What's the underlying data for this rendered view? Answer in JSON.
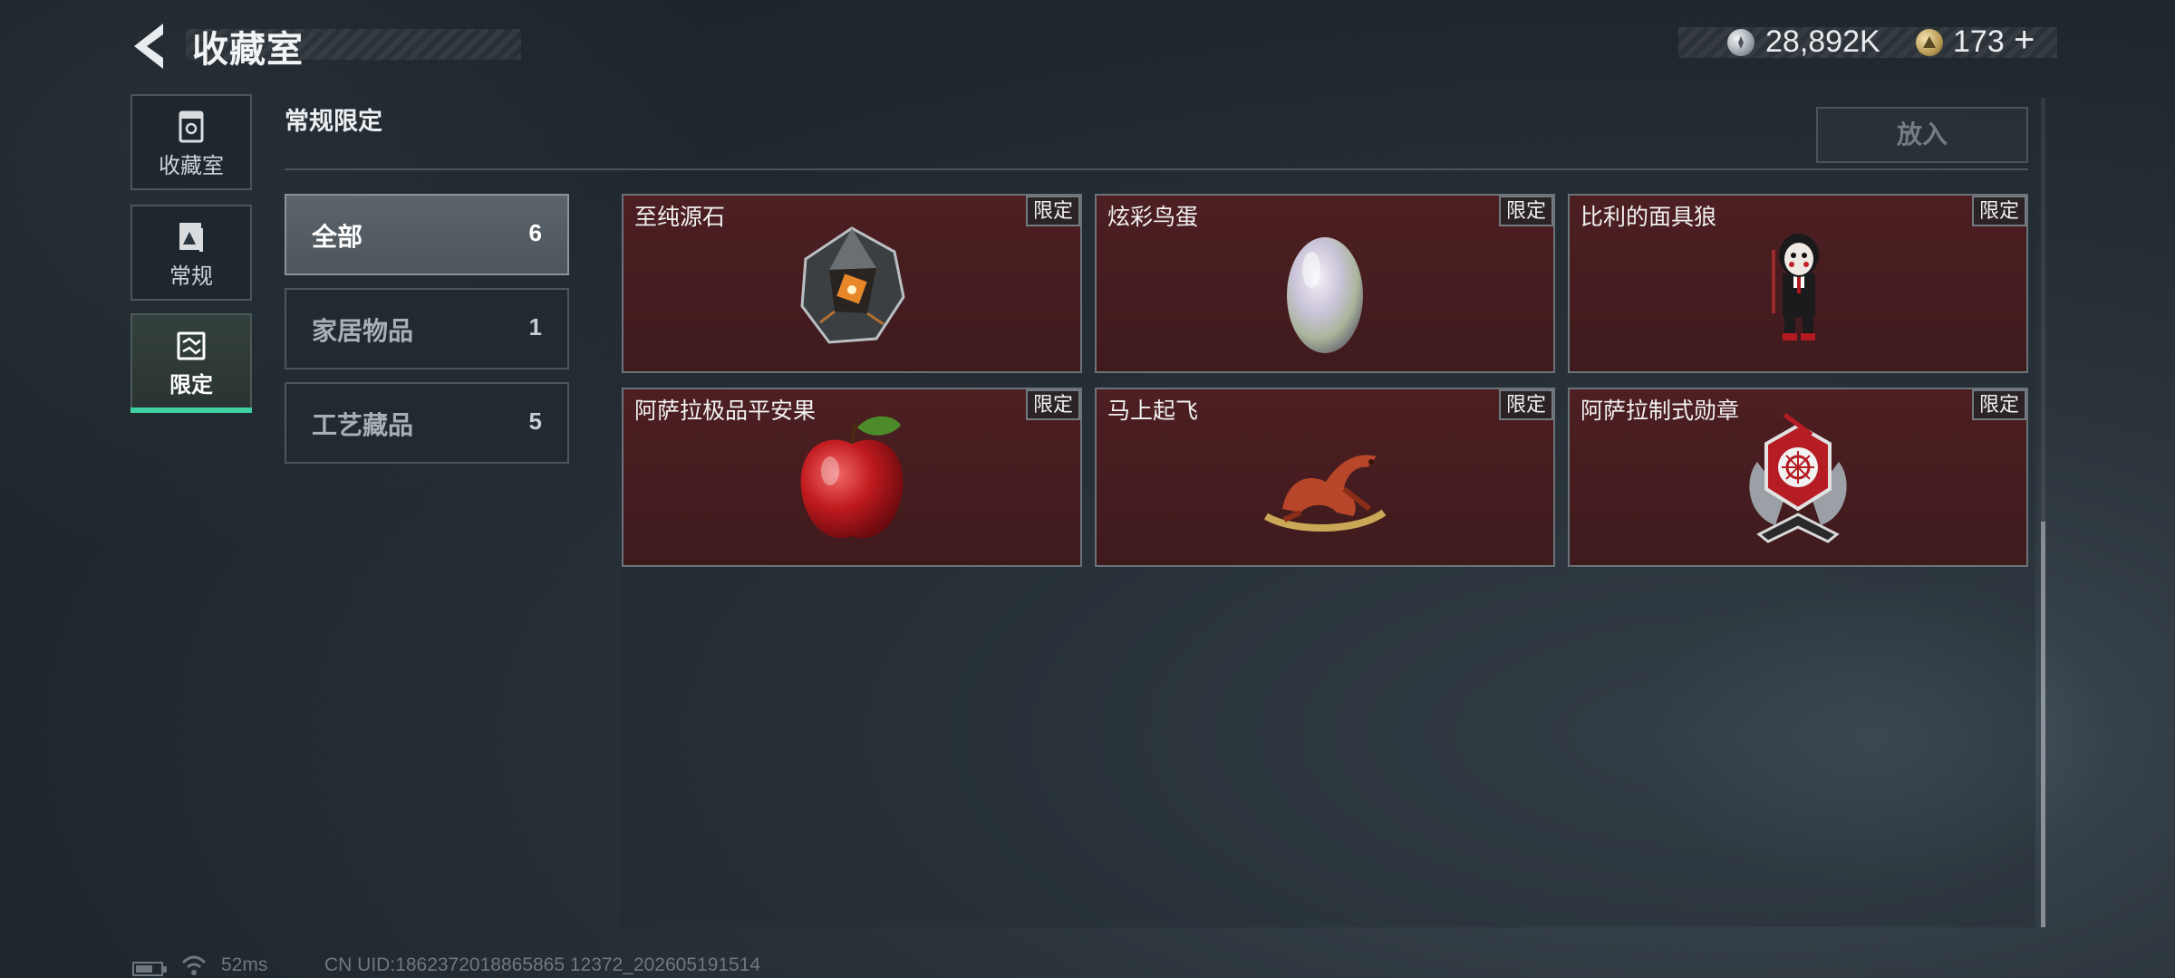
{
  "header": {
    "title": "收藏室",
    "silver_amount": "28,892K",
    "gold_amount": "173",
    "plus_label": "+"
  },
  "nav": {
    "items": [
      {
        "label": "收藏室",
        "icon": "display-case-icon"
      },
      {
        "label": "常规",
        "icon": "card-icon"
      },
      {
        "label": "限定",
        "icon": "limited-icon",
        "active": true
      }
    ]
  },
  "section": {
    "title": "常规限定",
    "put_in_label": "放入"
  },
  "categories": [
    {
      "label": "全部",
      "count": "6",
      "active": true
    },
    {
      "label": "家居物品",
      "count": "1"
    },
    {
      "label": "工艺藏品",
      "count": "5"
    }
  ],
  "items": [
    {
      "name": "至纯源石",
      "badge": "限定",
      "icon": "crystal-stone-icon"
    },
    {
      "name": "炫彩鸟蛋",
      "badge": "限定",
      "icon": "iridescent-egg-icon"
    },
    {
      "name": "比利的面具狼",
      "badge": "限定",
      "icon": "puppet-doll-icon"
    },
    {
      "name": "阿萨拉极品平安果",
      "badge": "限定",
      "icon": "apple-icon"
    },
    {
      "name": "马上起飞",
      "badge": "限定",
      "icon": "horse-statue-icon"
    },
    {
      "name": "阿萨拉制式勋章",
      "badge": "限定",
      "icon": "medal-icon"
    }
  ],
  "footer": {
    "ping": "52ms",
    "uid": "CN UID:1862372018865865 12372_202605191514"
  },
  "colors": {
    "accent": "#3fd0a4",
    "card_bg": "#4a1e21"
  }
}
